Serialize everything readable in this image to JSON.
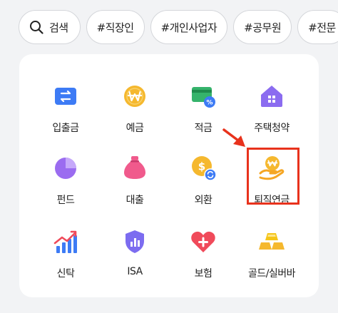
{
  "chips": {
    "search_label": "검색",
    "tags": [
      "#직장인",
      "#개인사업자",
      "#공무원",
      "#전문"
    ]
  },
  "menu": {
    "items": [
      {
        "label": "입출금",
        "icon": "transfer-icon"
      },
      {
        "label": "예금",
        "icon": "won-coin-icon"
      },
      {
        "label": "적금",
        "icon": "savings-card-icon"
      },
      {
        "label": "주택청약",
        "icon": "house-icon"
      },
      {
        "label": "펀드",
        "icon": "pie-chart-icon"
      },
      {
        "label": "대출",
        "icon": "money-bag-icon"
      },
      {
        "label": "외환",
        "icon": "exchange-coin-icon"
      },
      {
        "label": "퇴직연금",
        "icon": "pension-hand-icon"
      },
      {
        "label": "신탁",
        "icon": "growth-chart-icon"
      },
      {
        "label": "ISA",
        "icon": "shield-chart-icon"
      },
      {
        "label": "보험",
        "icon": "heart-plus-icon"
      },
      {
        "label": "골드/실버바",
        "icon": "gold-bars-icon"
      }
    ]
  },
  "colors": {
    "highlight": "#e8321c",
    "blue": "#3d7bf5",
    "gold": "#f5b82e",
    "purple": "#9b6cf0",
    "pink": "#f05a8c",
    "red": "#f04a5a"
  }
}
